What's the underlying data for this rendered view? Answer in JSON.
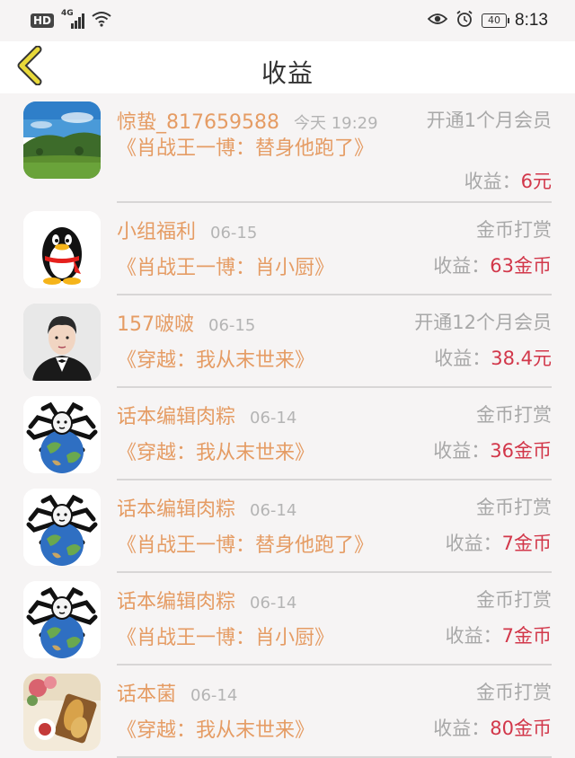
{
  "status_bar": {
    "hd": "HD",
    "network": "4G",
    "battery": "40",
    "time": "8:13"
  },
  "nav": {
    "title": "收益"
  },
  "entries": [
    {
      "name": "惊蛰_817659588",
      "time": "今天 19:29",
      "action": "开通1个月会员",
      "book": "《肖战王一博：替身他跑了》",
      "earn_label": "收益：",
      "earn_value": "6元",
      "avatar": "landscape-photo"
    },
    {
      "name": "小组福利",
      "time": "06-15",
      "action": "金币打赏",
      "book": "《肖战王一博：肖小厨》",
      "earn_label": "收益：",
      "earn_value": "63金币",
      "avatar": "penguin-logo"
    },
    {
      "name": "157啵啵",
      "time": "06-15",
      "action": "开通12个月会员",
      "book": "《穿越：我从末世来》",
      "earn_label": "收益：",
      "earn_value": "38.4元",
      "avatar": "person-photo"
    },
    {
      "name": "话本编辑肉粽",
      "time": "06-14",
      "action": "金币打赏",
      "book": "《穿越：我从末世来》",
      "earn_label": "收益：",
      "earn_value": "36金币",
      "avatar": "spider-earth-meme"
    },
    {
      "name": "话本编辑肉粽",
      "time": "06-14",
      "action": "金币打赏",
      "book": "《肖战王一博：替身他跑了》",
      "earn_label": "收益：",
      "earn_value": "7金币",
      "avatar": "spider-earth-meme"
    },
    {
      "name": "话本编辑肉粽",
      "time": "06-14",
      "action": "金币打赏",
      "book": "《肖战王一博：肖小厨》",
      "earn_label": "收益：",
      "earn_value": "7金币",
      "avatar": "spider-earth-meme"
    },
    {
      "name": "话本菌",
      "time": "06-14",
      "action": "金币打赏",
      "book": "《穿越：我从末世来》",
      "earn_label": "收益：",
      "earn_value": "80金币",
      "avatar": "food-photo"
    }
  ],
  "colors": {
    "accent": "#e59c64",
    "earn": "#d2374a",
    "muted": "#a8a8a8",
    "back_arrow": "#e8d93a"
  }
}
